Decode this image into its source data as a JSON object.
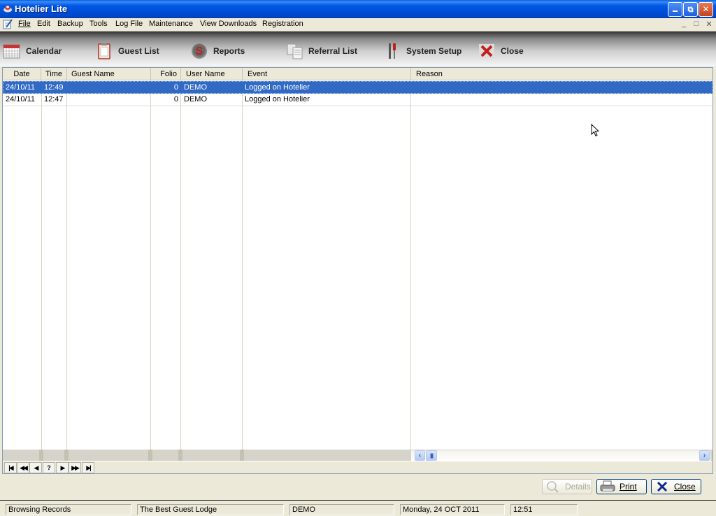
{
  "window": {
    "title": "Hotelier Lite",
    "controls": [
      "minimize",
      "restore",
      "close"
    ]
  },
  "menubar": {
    "items": [
      "File",
      "Edit",
      "Backup",
      "Tools",
      "Log File",
      "Maintenance",
      "View Downloads",
      "Registration"
    ],
    "mdi_controls": [
      "_",
      "□",
      "✕"
    ]
  },
  "toolbar": {
    "buttons": [
      {
        "label": "Calendar",
        "icon": "calendar-icon"
      },
      {
        "label": "Guest List",
        "icon": "clipboard-icon"
      },
      {
        "label": "Reports",
        "icon": "dollar-icon"
      },
      {
        "label": "Referral List",
        "icon": "documents-icon"
      },
      {
        "label": "System Setup",
        "icon": "tools-icon"
      },
      {
        "label": "Close",
        "icon": "close-x-icon"
      }
    ]
  },
  "grid": {
    "columns": [
      "Date",
      "Time",
      "Guest Name",
      "Folio",
      "User Name",
      "Event",
      "Reason"
    ],
    "rows": [
      {
        "date": "24/10/11",
        "time": "12:49",
        "guest_name": "",
        "folio": "0",
        "user_name": "DEMO",
        "event": "Logged on Hotelier",
        "reason": "",
        "selected": true
      },
      {
        "date": "24/10/11",
        "time": "12:47",
        "guest_name": "",
        "folio": "0",
        "user_name": "DEMO",
        "event": "Logged on Hotelier",
        "reason": "",
        "selected": false
      }
    ],
    "nav_buttons": [
      "first",
      "previous-page",
      "previous",
      "?",
      "next",
      "next-page",
      "last"
    ],
    "nav_symbols": [
      "|◀",
      "◀◀",
      "◀",
      "?",
      "▶",
      "▶▶",
      "▶|"
    ]
  },
  "actions": {
    "details": "Details",
    "print": "Print",
    "close": "Close"
  },
  "statusbar": {
    "mode": "Browsing Records",
    "property": "The Best Guest Lodge",
    "user": "DEMO",
    "date": "Monday, 24 OCT 2011",
    "time": "12:51"
  }
}
